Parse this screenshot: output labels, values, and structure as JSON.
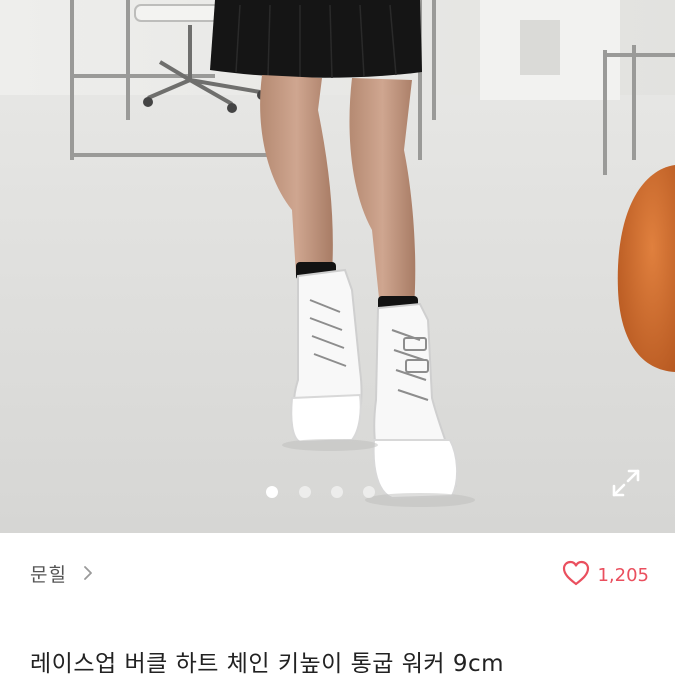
{
  "product": {
    "image": {
      "icon": "product-photo-white-lace-up-platform-boots",
      "slide_count": 4,
      "active_slide": 1
    },
    "expand_icon": "expand-icon",
    "seller": {
      "name": "문힐",
      "chevron_icon": "chevron-right-icon"
    },
    "likes": {
      "icon": "heart-outline-icon",
      "count": "1,205",
      "color": "#ea4f5e"
    },
    "title": "레이스업 버클 하트 체인 키높이 통굽 워커 9cm"
  }
}
